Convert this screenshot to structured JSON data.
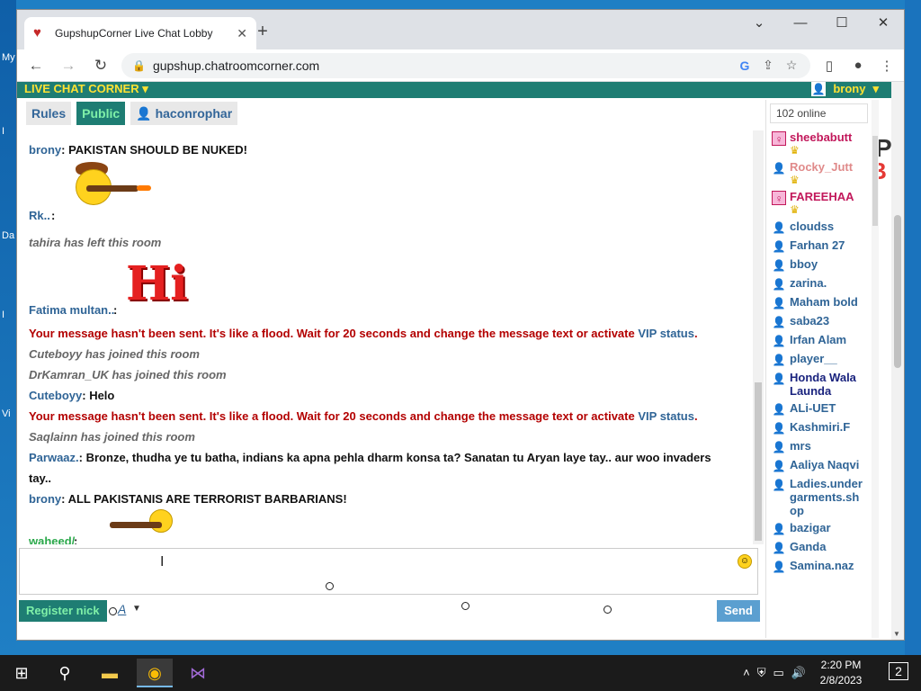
{
  "desktop": {
    "labels": [
      "My",
      "I",
      "Da",
      "I",
      "Vi"
    ]
  },
  "browser": {
    "tab_title": "GupshupCorner Live Chat Lobby",
    "url": "gupshup.chatroomcorner.com"
  },
  "site": {
    "brand": "LIVE CHAT CORNER",
    "username": "brony",
    "tabs": [
      "Rules",
      "Public",
      "haconrophar"
    ],
    "logo_text1": "GUP",
    "logo_text2": "LOB"
  },
  "messages": [
    {
      "type": "chat",
      "nick": "brony",
      "text": "PAKISTAN SHOULD BE NUKED!"
    },
    {
      "type": "image",
      "nick": "Rk..",
      "image": "cowboy-gun-smiley"
    },
    {
      "type": "system",
      "text": "tahira has left this room"
    },
    {
      "type": "image",
      "nick": "Fatima multan..",
      "image": "hi-sticker"
    },
    {
      "type": "warn",
      "text": "Your message hasn't been sent. It's like a flood. Wait for 20 seconds and change the message text or activate",
      "link": "VIP status"
    },
    {
      "type": "system",
      "text": "Cuteboyy has joined this room"
    },
    {
      "type": "system",
      "text": "DrKamran_UK has joined this room"
    },
    {
      "type": "chat",
      "nick": "Cuteboyy",
      "text": "Helo"
    },
    {
      "type": "warn",
      "text": "Your message hasn't been sent. It's like a flood. Wait for 20 seconds and change the message text or activate",
      "link": "VIP status"
    },
    {
      "type": "system",
      "text": "Saqlainn has joined this room"
    },
    {
      "type": "chat",
      "nick": "Parwaaz.",
      "text": "Bronze, thudha ye tu batha, indians ka apna pehla dharm konsa ta? Sanatan tu Aryan laye tay.. aur woo invaders tay.."
    },
    {
      "type": "chat",
      "nick": "brony",
      "text": "ALL PAKISTANIS ARE TERRORIST BARBARIANS!"
    },
    {
      "type": "image",
      "nick": "waheed/",
      "image": "gun-smiley",
      "green": true
    }
  ],
  "composer": {
    "value": ""
  },
  "bottom": {
    "register": "Register nick",
    "font": "A",
    "send": "Send"
  },
  "userlist": {
    "online": "102 online",
    "users": [
      {
        "name": "sheebabutt",
        "style": "pink",
        "crown": true
      },
      {
        "name": "Rocky_Jutt",
        "style": "muted",
        "crown": true
      },
      {
        "name": "FAREEHAA",
        "style": "pink",
        "crown": true
      },
      {
        "name": "cloudss"
      },
      {
        "name": "Farhan 27"
      },
      {
        "name": "bboy"
      },
      {
        "name": "zarina."
      },
      {
        "name": "Maham bold"
      },
      {
        "name": "saba23"
      },
      {
        "name": "Irfan Alam"
      },
      {
        "name": "player__"
      },
      {
        "name": "Honda Wala Launda",
        "style": "dark"
      },
      {
        "name": "ALi-UET"
      },
      {
        "name": "Kashmiri.F"
      },
      {
        "name": "mrs"
      },
      {
        "name": "Aaliya Naqvi"
      },
      {
        "name": "Ladies.undergarments.shop"
      },
      {
        "name": "bazigar"
      },
      {
        "name": "Ganda"
      },
      {
        "name": "Samina.naz"
      }
    ]
  },
  "taskbar": {
    "time": "2:20 PM",
    "date": "2/8/2023",
    "notifications": "2"
  }
}
